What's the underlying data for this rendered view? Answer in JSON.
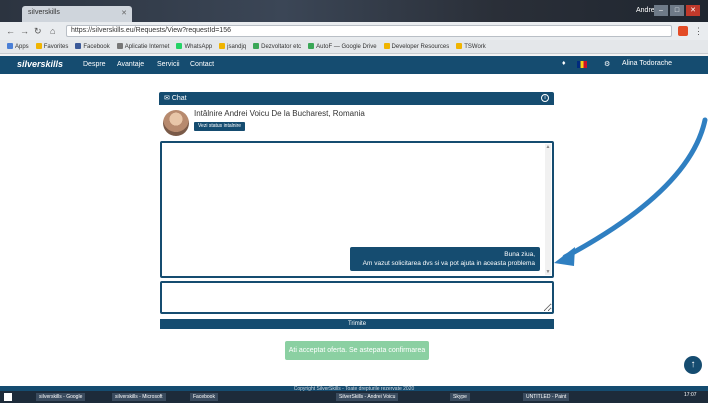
{
  "browser": {
    "tab_title": "siIverskills",
    "user_label": "Andrei",
    "url": "https://siIverskills.eu/Requests/View?requestId=156",
    "bookmarks": [
      {
        "label": "Apps",
        "color": "#4a7fd6"
      },
      {
        "label": "Favorites",
        "color": "#f0b400"
      },
      {
        "label": "Facebook",
        "color": "#3b5998"
      },
      {
        "label": "Aplicatie Internet",
        "color": "#777777"
      },
      {
        "label": "WhatsApp",
        "color": "#25d366"
      },
      {
        "label": "jsandjq",
        "color": "#f0b400"
      },
      {
        "label": "Dezvoltator etc",
        "color": "#3aa757"
      },
      {
        "label": "AutoF — Google Drive",
        "color": "#3aa757"
      },
      {
        "label": "Developer Resources",
        "color": "#f0b400"
      },
      {
        "label": "TSWork",
        "color": "#f0b400"
      }
    ]
  },
  "site": {
    "logo": "siIverskills",
    "nav": [
      "Despre",
      "Avantaje",
      "Servicii",
      "Contact"
    ],
    "user_name": "Alina Todorache"
  },
  "chat": {
    "header": "Chat",
    "meeting_title": "Intâlnire Andrei Voicu De la Bucharest, Romania",
    "status_button": "Vezi status intalnire",
    "message_lines": [
      "Buna ziua,",
      "Am vazut solicitarea dvs si va pot ajuta in aceasta problema"
    ],
    "compose_placeholder": "",
    "send_label": "Trimite",
    "accept_label": "Ati acceptat oferta. Se astepata confirmarea"
  },
  "footer": {
    "text": "Copyright SilverSkills - Toate drepturile rezervate 2020"
  },
  "taskbar": {
    "items": [
      "siIverskills - Google",
      "siIverskills - Microsoft",
      "Facebook",
      "SilverSkills - Andrei Voicu",
      "Skype",
      "UNTITLED - Paint"
    ],
    "clock": "17:07"
  },
  "colors": {
    "brand": "#154c70",
    "accept": "#8bd0a2",
    "arrow": "#2f7fc1"
  }
}
